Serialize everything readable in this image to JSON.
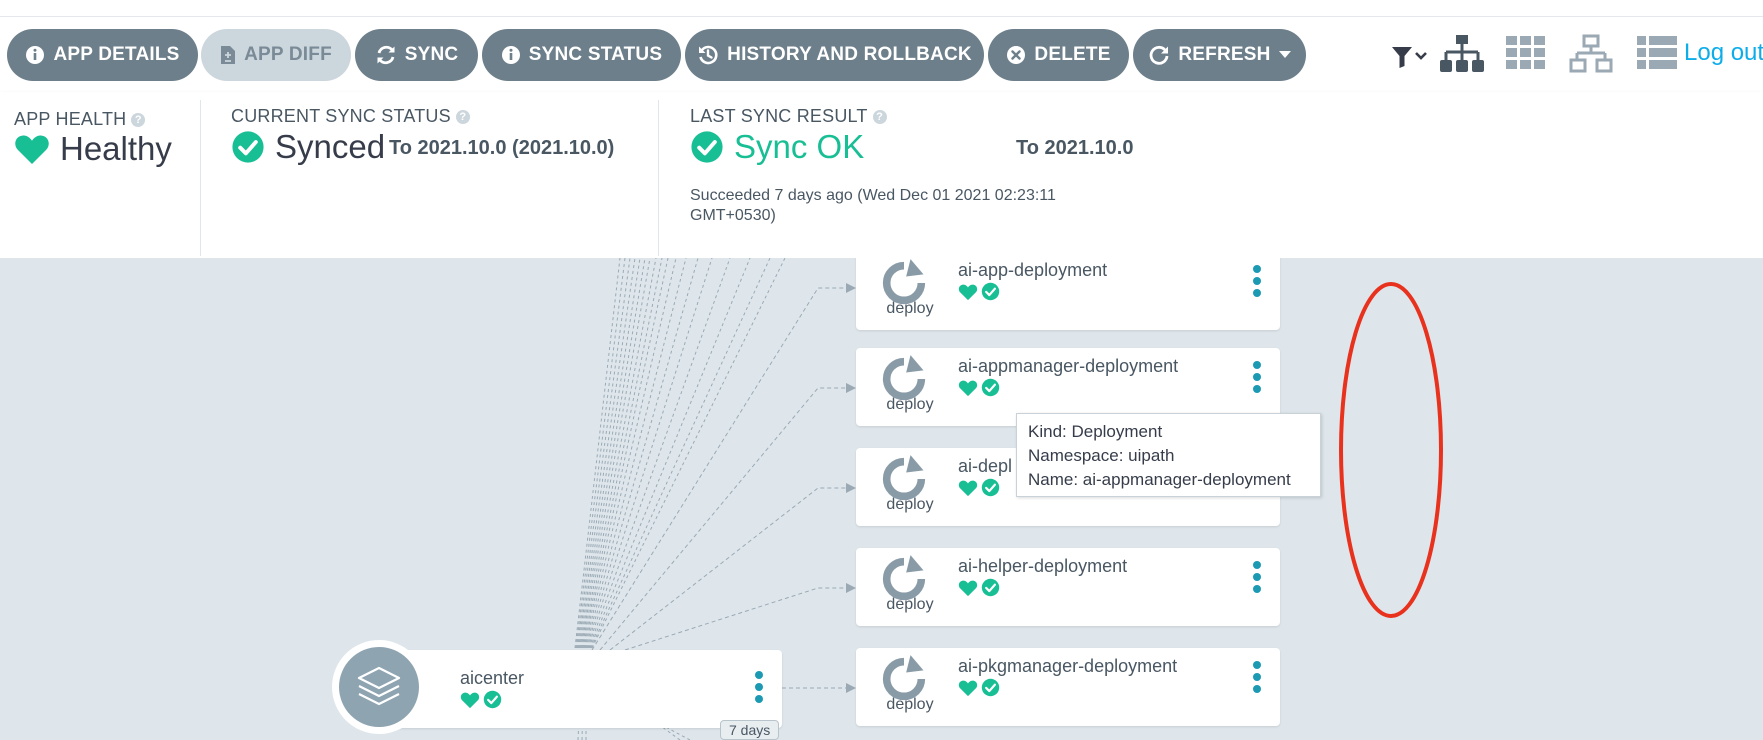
{
  "toolbar": {
    "buttons": [
      {
        "label": "APP DETAILS",
        "icon": "info-icon"
      },
      {
        "label": "APP DIFF",
        "icon": "file-diff-icon",
        "disabled": true
      },
      {
        "label": "SYNC",
        "icon": "sync-icon"
      },
      {
        "label": "SYNC STATUS",
        "icon": "info-icon"
      },
      {
        "label": "HISTORY AND ROLLBACK",
        "icon": "history-icon"
      },
      {
        "label": "DELETE",
        "icon": "delete-icon"
      },
      {
        "label": "REFRESH",
        "icon": "refresh-icon"
      }
    ],
    "logout_label": "Log out"
  },
  "status": {
    "app_health": {
      "label": "APP HEALTH",
      "value": "Healthy"
    },
    "current_sync": {
      "label": "CURRENT SYNC STATUS",
      "value": "Synced",
      "to": "To 2021.10.0 (2021.10.0)"
    },
    "last_sync": {
      "label": "LAST SYNC RESULT",
      "value": "Sync OK",
      "to": "To 2021.10.0",
      "detail_line1": "Succeeded 7 days ago (Wed Dec 01 2021 02:23:11",
      "detail_line2": "GMT+0530)"
    }
  },
  "tree": {
    "app": {
      "name": "aicenter",
      "age": "7 days"
    },
    "resources": [
      {
        "name": "ai-app-deployment",
        "kind": "deploy"
      },
      {
        "name": "ai-appmanager-deployment",
        "kind": "deploy"
      },
      {
        "name": "ai-deployer-deployment",
        "kind": "deploy",
        "visible_name": "ai-depl"
      },
      {
        "name": "ai-helper-deployment",
        "kind": "deploy"
      },
      {
        "name": "ai-pkgmanager-deployment",
        "kind": "deploy"
      }
    ]
  },
  "tooltip": {
    "kind": "Kind: Deployment",
    "namespace": "Namespace: uipath",
    "name": "Name: ai-appmanager-deployment"
  },
  "colors": {
    "button": "#6d7f8b",
    "button_disabled": "#ccd6dd",
    "healthy": "#18be94",
    "accent": "#0dadea",
    "annotation": "#e8321e",
    "canvas": "#dee6eb"
  }
}
